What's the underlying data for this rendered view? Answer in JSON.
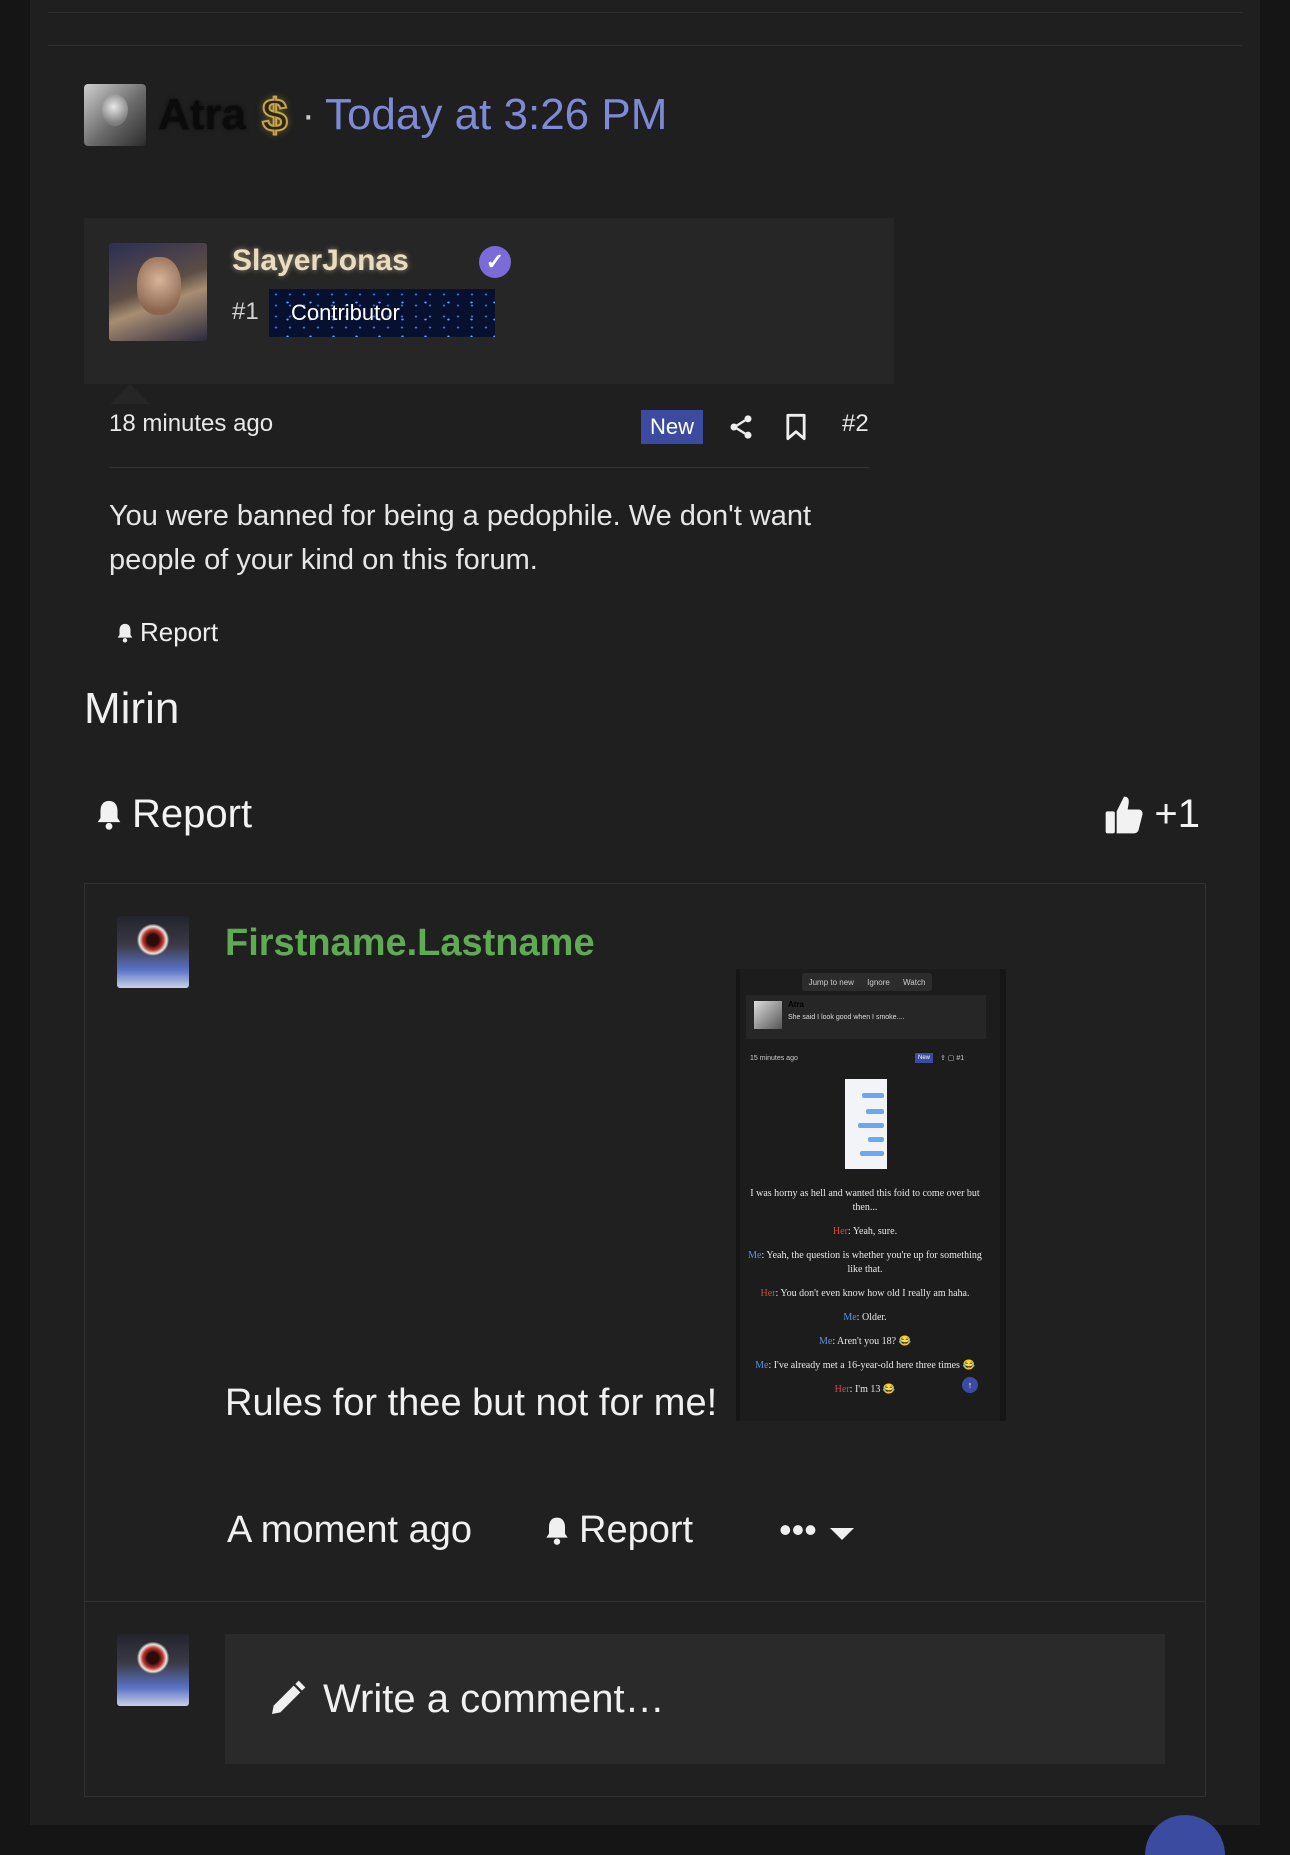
{
  "header": {
    "username": "Atra",
    "badge_symbol": "$",
    "separator": "·",
    "timestamp": "Today at 3:26 PM"
  },
  "quote": {
    "author": "SlayerJonas",
    "rank_number": "#1",
    "rank_badge": "Contributor",
    "time_ago": "18 minutes ago",
    "new_badge": "New",
    "post_number": "#2",
    "body": "You were banned for being a pedophile. We don't want people of your kind on this forum.",
    "report_label": "Report"
  },
  "post": {
    "body": "Mirin",
    "report_label": "Report",
    "reaction_count": "+1"
  },
  "comment": {
    "author": "Firstname.Lastname",
    "text": "Rules for thee but not for me!",
    "time_ago": "A moment ago",
    "report_label": "Report",
    "more_label": "•••",
    "thumbnail": {
      "tabs": [
        "Jump to new",
        "Ignore",
        "Watch"
      ],
      "author": "Atra",
      "subtitle": "She said I look good when I smoke....",
      "time_ago": "15 minutes ago",
      "new_badge": "New",
      "post_number": "#1",
      "lines": [
        {
          "speaker": "",
          "text": "I was horny as hell and wanted this foid to come over but then..."
        },
        {
          "speaker": "Her",
          "text": ": Yeah, sure."
        },
        {
          "speaker": "Me",
          "text": ": Yeah, the question is whether you're up for something like that."
        },
        {
          "speaker": "Her",
          "text": ": You don't even know how old I really am haha."
        },
        {
          "speaker": "Me",
          "text": ": Older."
        },
        {
          "speaker": "Me",
          "text": ": Aren't you 18? 😂"
        },
        {
          "speaker": "Me",
          "text": ": I've already met a 16-year-old here three times 😂"
        },
        {
          "speaker": "Her",
          "text": ": I'm 13 😂"
        }
      ]
    }
  },
  "composer": {
    "placeholder": "Write a comment…"
  },
  "colors": {
    "accent": "#7e8ad6",
    "username_green": "#5fab53",
    "badge_blue": "#3b4ba0"
  },
  "icons": [
    "bell-icon",
    "share-icon",
    "bookmark-icon",
    "thumbs-up-icon",
    "pencil-icon",
    "check-icon",
    "caret-down-icon"
  ]
}
